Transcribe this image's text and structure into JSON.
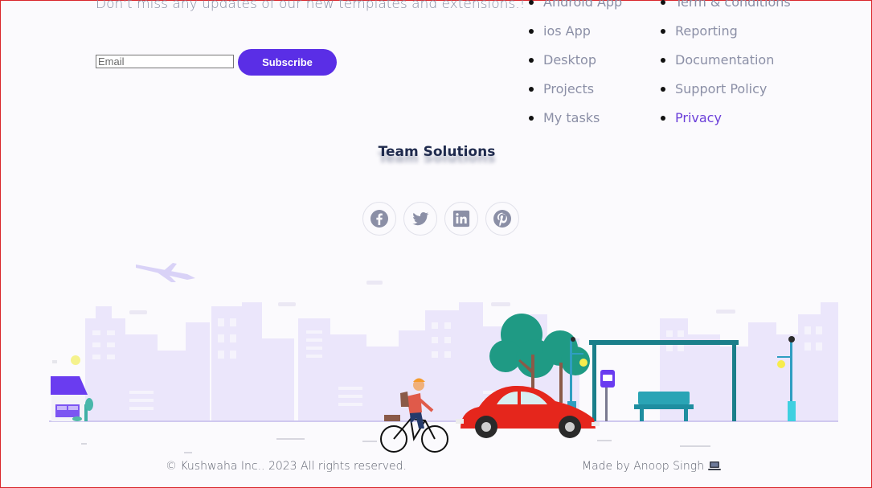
{
  "newsletter": {
    "tagline": "Don't miss any updates of our new templates and extensions.!",
    "email_placeholder": "Email",
    "subscribe_label": "Subscribe"
  },
  "links_col1": [
    {
      "label": "Android App"
    },
    {
      "label": "ios App"
    },
    {
      "label": "Desktop"
    },
    {
      "label": "Projects"
    },
    {
      "label": "My tasks"
    }
  ],
  "links_col2": [
    {
      "label": "Term & conditions"
    },
    {
      "label": "Reporting"
    },
    {
      "label": "Documentation"
    },
    {
      "label": "Support Policy"
    },
    {
      "label": "Privacy"
    }
  ],
  "brand": "Team Solutions",
  "socials": [
    {
      "icon": "facebook-icon"
    },
    {
      "icon": "twitter-icon"
    },
    {
      "icon": "linkedin-icon"
    },
    {
      "icon": "pinterest-icon"
    }
  ],
  "footer": {
    "copyright": "© Kushwaha Inc.. 2023 All rights reserved.",
    "made_by": "Made by Anoop Singh"
  },
  "colors": {
    "accent": "#5a2ee6",
    "link": "#8b8fa6",
    "active_link": "#6b3fd9",
    "city": "#e9e4fb"
  }
}
